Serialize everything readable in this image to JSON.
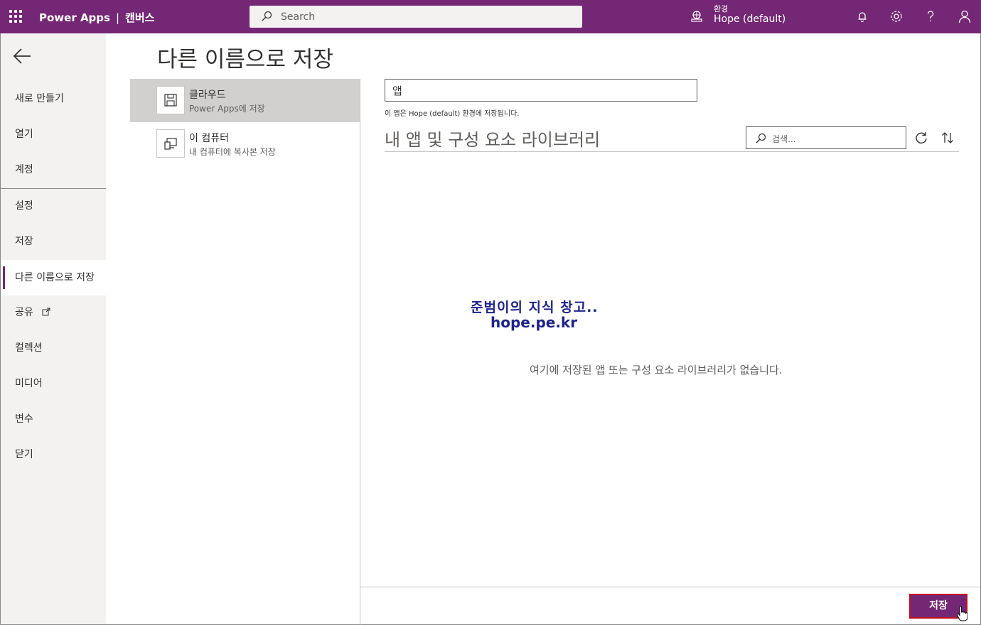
{
  "topbar": {
    "app_name": "Power Apps",
    "separator": "|",
    "mode": "캔버스",
    "search_placeholder": "Search",
    "env_label": "환경",
    "env_value": "Hope (default)"
  },
  "nav": {
    "items": [
      {
        "label": "새로 만들기"
      },
      {
        "label": "열기"
      },
      {
        "label": "계정"
      },
      {
        "label": "설정"
      },
      {
        "label": "저장"
      },
      {
        "label": "다른 이름으로 저장"
      },
      {
        "label": "공유"
      },
      {
        "label": "컬렉션"
      },
      {
        "label": "미디어"
      },
      {
        "label": "변수"
      },
      {
        "label": "닫기"
      }
    ],
    "active": "다른 이름으로 저장"
  },
  "page": {
    "title": "다른 이름으로 저장"
  },
  "locations": [
    {
      "title": "클라우드",
      "subtitle": "Power Apps에 저장",
      "icon": "floppy-disk-icon",
      "selected": true
    },
    {
      "title": "이 컴퓨터",
      "subtitle": "내 컴퓨터에 복사본 저장",
      "icon": "computer-icon",
      "selected": false
    }
  ],
  "form": {
    "app_name_value": "앱",
    "env_note": "이 앱은 Hope (default) 환경에 저장됩니다."
  },
  "library": {
    "title": "내 앱 및 구성 요소 라이브러리",
    "search_placeholder": "검색...",
    "empty_message": "여기에 저장된 앱 또는 구성 요소 라이브러리가 없습니다."
  },
  "watermark": {
    "line1": "준범이의 지식 창고..",
    "line2": "hope.pe.kr"
  },
  "footer": {
    "save_label": "저장"
  },
  "colors": {
    "brand": "#742774",
    "highlight_border": "#c50f1f",
    "watermark": "#1d2488"
  }
}
